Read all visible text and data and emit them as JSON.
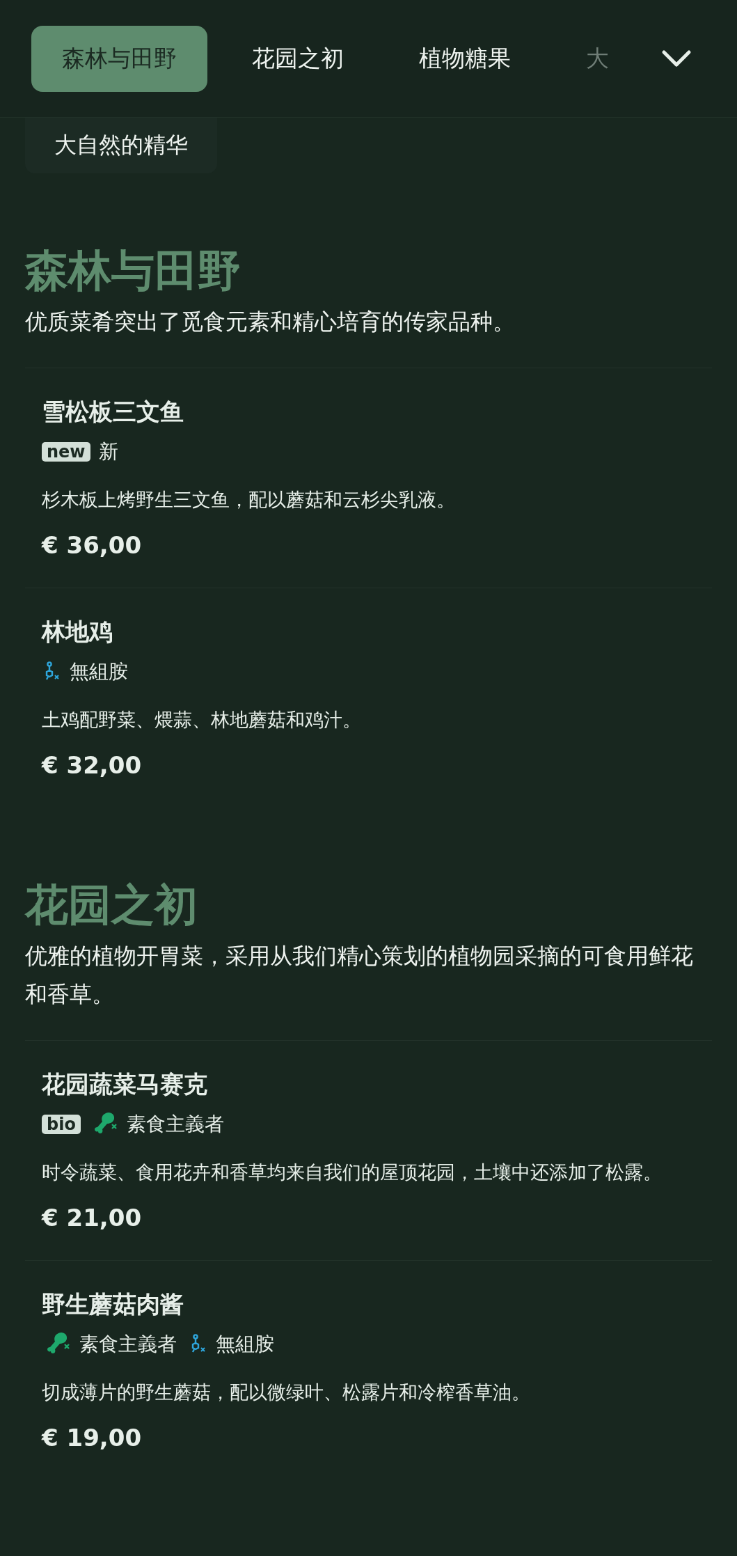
{
  "nav": {
    "tabs": [
      {
        "label": "森林与田野",
        "selected": true
      },
      {
        "label": "花园之初",
        "selected": false
      },
      {
        "label": "植物糖果",
        "selected": false
      },
      {
        "label": "大",
        "selected": false
      }
    ],
    "overflow_tab": {
      "label": "大自然的精华"
    }
  },
  "sections": [
    {
      "title": "森林与田野",
      "description": "优质菜肴突出了觅食元素和精心培育的传家品种。",
      "items": [
        {
          "name": "雪松板三文鱼",
          "tags": [
            {
              "kind": "badge",
              "text": "new"
            },
            {
              "kind": "note",
              "text": "新"
            }
          ],
          "description": "杉木板上烤野生三文鱼，配以蘑菇和云杉尖乳液。",
          "price": "€ 36,00"
        },
        {
          "name": "林地鸡",
          "tags": [
            {
              "kind": "histamine",
              "text": "無組胺"
            }
          ],
          "description": "土鸡配野菜、煨蒜、林地蘑菇和鸡汁。",
          "price": "€ 32,00"
        }
      ]
    },
    {
      "title": "花园之初",
      "description": "优雅的植物开胃菜，采用从我们精心策划的植物园采摘的可食用鲜花和香草。",
      "items": [
        {
          "name": "花园蔬菜马赛克",
          "tags": [
            {
              "kind": "badge",
              "text": "bio"
            },
            {
              "kind": "vegan",
              "text": "素食主義者"
            }
          ],
          "description": "时令蔬菜、食用花卉和香草均来自我们的屋顶花园，土壤中还添加了松露。",
          "price": "€ 21,00"
        },
        {
          "name": "野生蘑菇肉酱",
          "tags": [
            {
              "kind": "vegan",
              "text": "素食主義者"
            },
            {
              "kind": "histamine",
              "text": "無組胺"
            }
          ],
          "description": "切成薄片的野生蘑菇，配以微绿叶、松露片和冷榨香草油。",
          "price": "€ 19,00"
        }
      ]
    }
  ]
}
